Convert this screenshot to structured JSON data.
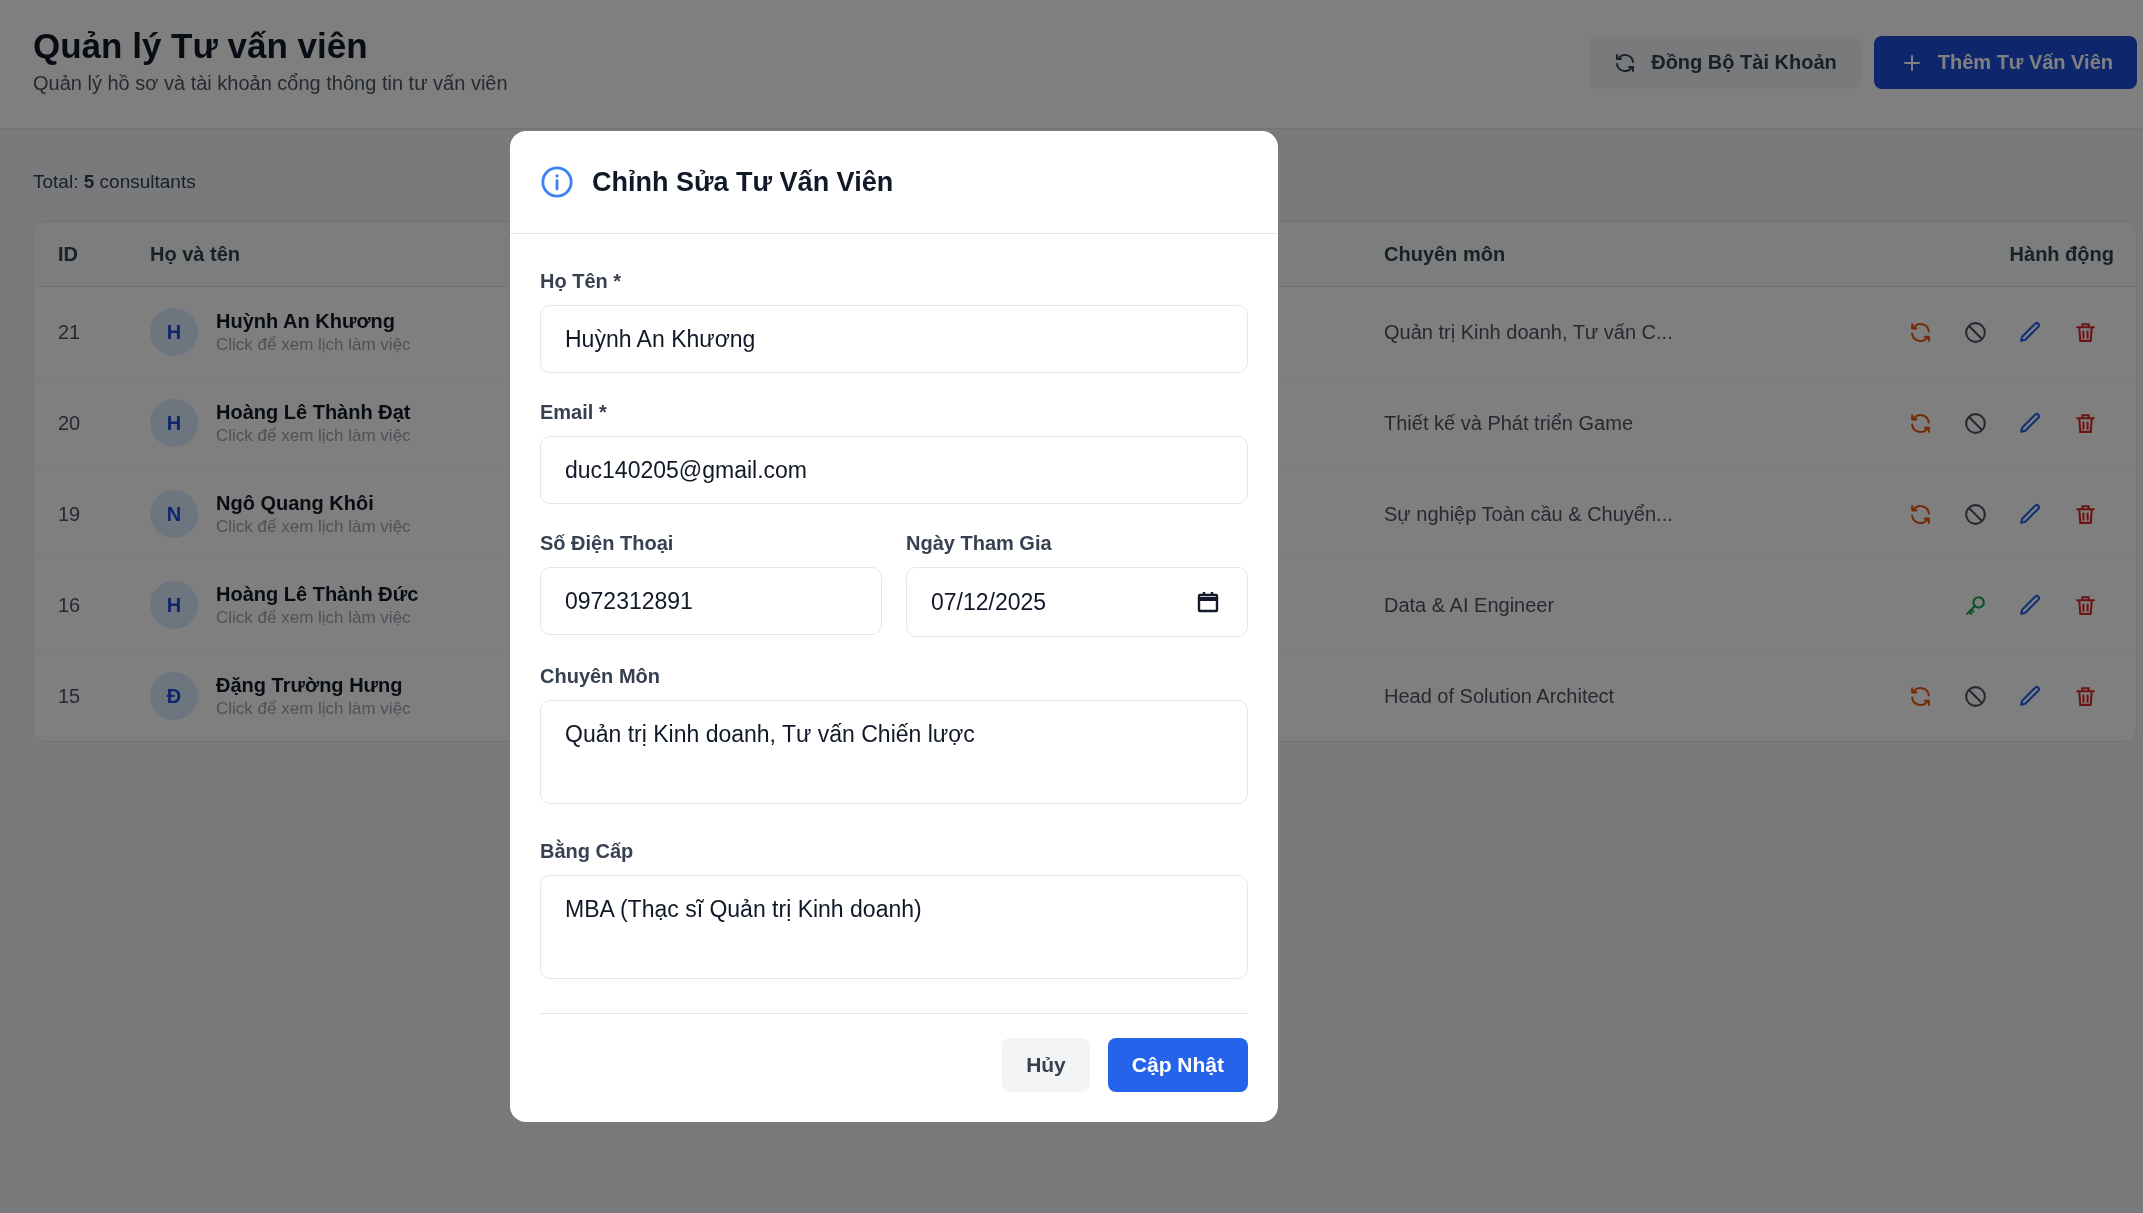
{
  "header": {
    "title": "Quản lý Tư vấn viên",
    "subtitle": "Quản lý hồ sơ và tài khoản cổng thông tin tư vấn viên",
    "buttons": [
      {
        "label": "Đồng Bộ Tài Khoản",
        "kind": "secondary"
      },
      {
        "label": "Thêm Tư Vấn Viên",
        "kind": "primary"
      }
    ]
  },
  "total": "Total: **5** consultants",
  "table": {
    "columns": [
      "ID",
      "Họ và tên",
      "Chuyên môn",
      "Hành động"
    ],
    "rows": [
      {
        "id": "21",
        "initial": "H",
        "name": "Huỳnh An Khương",
        "hint": "Click để xem lịch làm việc",
        "specialty": "Quản trị Kinh doanh, Tư vấn C...",
        "actions": [
          {
            "kind": "sync"
          },
          {
            "kind": "block"
          },
          {
            "kind": "edit"
          },
          {
            "kind": "delete"
          }
        ]
      },
      {
        "id": "20",
        "initial": "H",
        "name": "Hoàng Lê Thành Đạt",
        "hint": "Click để xem lịch làm việc",
        "specialty": "Thiết kế và Phát triển Game",
        "actions": [
          {
            "kind": "sync"
          },
          {
            "kind": "block"
          },
          {
            "kind": "edit"
          },
          {
            "kind": "delete"
          }
        ]
      },
      {
        "id": "19",
        "initial": "N",
        "name": "Ngô Quang Khôi",
        "hint": "Click để xem lịch làm việc",
        "specialty": "Sự nghiệp Toàn cầu & Chuyển...",
        "actions": [
          {
            "kind": "sync"
          },
          {
            "kind": "block"
          },
          {
            "kind": "edit"
          },
          {
            "kind": "delete"
          }
        ]
      },
      {
        "id": "16",
        "initial": "H",
        "name": "Hoàng Lê Thành Đức",
        "hint": "Click để xem lịch làm việc",
        "specialty": "Data & AI Engineer",
        "actions": [
          {
            "kind": "key"
          },
          {
            "kind": "edit"
          },
          {
            "kind": "delete"
          }
        ]
      },
      {
        "id": "15",
        "initial": "Đ",
        "name": "Đặng Trường Hưng",
        "hint": "Click để xem lịch làm việc",
        "specialty": "Head of Solution Architect",
        "actions": [
          {
            "kind": "sync"
          },
          {
            "kind": "block"
          },
          {
            "kind": "edit"
          },
          {
            "kind": "delete"
          }
        ]
      }
    ]
  },
  "modal": {
    "title": "Chỉnh Sửa Tư Vấn Viên",
    "rows": [
      {
        "fields": [
          {
            "label": "Họ Tên *",
            "value": "Huỳnh An Khương",
            "kind": "text"
          }
        ]
      },
      {
        "fields": [
          {
            "label": "Email *",
            "value": "duc140205@gmail.com",
            "kind": "text"
          }
        ]
      },
      {
        "fields": [
          {
            "label": "Số Điện Thoại",
            "value": "0972312891",
            "kind": "text"
          },
          {
            "label": "Ngày Tham Gia",
            "value": "07/12/2025",
            "kind": "date"
          }
        ]
      },
      {
        "fields": [
          {
            "label": "Chuyên Môn",
            "value": "Quản trị Kinh doanh, Tư vấn Chiến lược",
            "kind": "textarea"
          }
        ]
      },
      {
        "fields": [
          {
            "label": "Bằng Cấp",
            "value": "MBA (Thạc sĩ Quản trị Kinh doanh)",
            "kind": "textarea"
          }
        ]
      }
    ],
    "buttons": [
      {
        "label": "Hủy",
        "kind": "secondary"
      },
      {
        "label": "Cập Nhật",
        "kind": "primary"
      }
    ]
  }
}
